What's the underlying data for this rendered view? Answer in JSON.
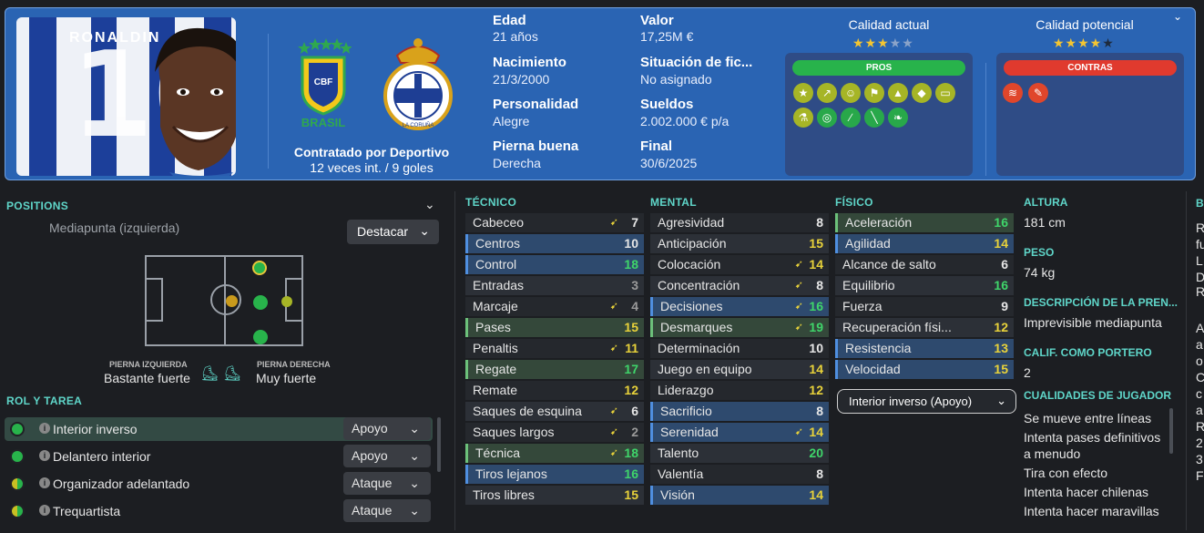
{
  "player": {
    "shirt_name": "RONALDIN",
    "shirt_number": "10",
    "nation": "BRASIL",
    "club_crest_text": "REAL CLUB DEPORTIVO · LA CORUÑA",
    "contract_line": "Contratado por Deportivo",
    "caps_line": "12 veces int. / 9 goles"
  },
  "info": {
    "edad_label": "Edad",
    "edad": "21 años",
    "nacimiento_label": "Nacimiento",
    "nacimiento": "21/3/2000",
    "personalidad_label": "Personalidad",
    "personalidad": "Alegre",
    "pierna_label": "Pierna buena",
    "pierna": "Derecha",
    "valor_label": "Valor",
    "valor": "17,25M €",
    "situacion_label": "Situación de fic...",
    "situacion": "No asignado",
    "sueldos_label": "Sueldos",
    "sueldos": "2.002.000 € p/a",
    "final_label": "Final",
    "final": "30/6/2025"
  },
  "quality": {
    "actual_label": "Calidad actual",
    "actual_stars": 3,
    "actual_half": true,
    "potencial_label": "Calidad potencial",
    "potencial_stars": 4
  },
  "pros": {
    "label": "PROS",
    "icons": [
      "star-icon",
      "trend-icon",
      "head-icon",
      "flag-icon",
      "cone-icon",
      "cones-icon",
      "pitch-icon",
      "flask-icon",
      "target-icon",
      "bandage-icon",
      "syringe-icon",
      "leaf-icon"
    ]
  },
  "contras": {
    "label": "CONTRAS",
    "icons": [
      "spring-icon",
      "clipboard-icon"
    ]
  },
  "positions": {
    "title": "POSITIONS",
    "current": "Mediapunta (izquierda)",
    "highlight_label": "Destacar",
    "left_foot_label": "PIERNA IZQUIERDA",
    "left_foot": "Bastante fuerte",
    "right_foot_label": "PIERNA DERECHA",
    "right_foot": "Muy fuerte"
  },
  "roles": {
    "title": "ROL Y TAREA",
    "items": [
      {
        "name": "Interior inverso",
        "duty": "Apoyo"
      },
      {
        "name": "Delantero interior",
        "duty": "Apoyo"
      },
      {
        "name": "Organizador adelantado",
        "duty": "Ataque"
      },
      {
        "name": "Trequartista",
        "duty": "Ataque"
      }
    ]
  },
  "tecnico": {
    "title": "TÉCNICO",
    "rows": [
      {
        "n": "Cabeceo",
        "v": "7"
      },
      {
        "n": "Centros",
        "v": "10"
      },
      {
        "n": "Control",
        "v": "18"
      },
      {
        "n": "Entradas",
        "v": "3"
      },
      {
        "n": "Marcaje",
        "v": "4"
      },
      {
        "n": "Pases",
        "v": "15"
      },
      {
        "n": "Penaltis",
        "v": "11"
      },
      {
        "n": "Regate",
        "v": "17"
      },
      {
        "n": "Remate",
        "v": "12"
      },
      {
        "n": "Saques de esquina",
        "v": "6"
      },
      {
        "n": "Saques largos",
        "v": "2"
      },
      {
        "n": "Técnica",
        "v": "18"
      },
      {
        "n": "Tiros lejanos",
        "v": "16"
      },
      {
        "n": "Tiros libres",
        "v": "15"
      }
    ]
  },
  "mental": {
    "title": "MENTAL",
    "rows": [
      {
        "n": "Agresividad",
        "v": "8"
      },
      {
        "n": "Anticipación",
        "v": "15"
      },
      {
        "n": "Colocación",
        "v": "14"
      },
      {
        "n": "Concentración",
        "v": "8"
      },
      {
        "n": "Decisiones",
        "v": "16"
      },
      {
        "n": "Desmarques",
        "v": "19"
      },
      {
        "n": "Determinación",
        "v": "10"
      },
      {
        "n": "Juego en equipo",
        "v": "14"
      },
      {
        "n": "Liderazgo",
        "v": "12"
      },
      {
        "n": "Sacrificio",
        "v": "8"
      },
      {
        "n": "Serenidad",
        "v": "14"
      },
      {
        "n": "Talento",
        "v": "20"
      },
      {
        "n": "Valentía",
        "v": "8"
      },
      {
        "n": "Visión",
        "v": "14"
      }
    ]
  },
  "fisico": {
    "title": "FÍSICO",
    "rows": [
      {
        "n": "Aceleración",
        "v": "16"
      },
      {
        "n": "Agilidad",
        "v": "14"
      },
      {
        "n": "Alcance de salto",
        "v": "6"
      },
      {
        "n": "Equilibrio",
        "v": "16"
      },
      {
        "n": "Fuerza",
        "v": "9"
      },
      {
        "n": "Recuperación físi...",
        "v": "12"
      },
      {
        "n": "Resistencia",
        "v": "13"
      },
      {
        "n": "Velocidad",
        "v": "15"
      }
    ],
    "role_select": "Interior inverso (Apoyo)"
  },
  "side": {
    "altura_label": "ALTURA",
    "altura": "181 cm",
    "peso_label": "PESO",
    "peso": "74 kg",
    "desc_label": "DESCRIPCIÓN DE LA PREN...",
    "desc": "Imprevisible mediapunta",
    "portero_label": "CALIF. COMO PORTERO",
    "portero": "2",
    "cualidades_label": "CUALIDADES DE JUGADOR",
    "cualidades": [
      "Se mueve entre líneas",
      "Intenta pases definitivos",
      "a menudo",
      "Tira con efecto",
      "Intenta hacer chilenas",
      "Intenta hacer maravillas"
    ]
  },
  "edge_text": {
    "h": "B",
    "lines": [
      "R",
      "fu",
      "L",
      "D",
      "R",
      "A",
      "a",
      "o",
      "C",
      "c",
      "a",
      "R",
      "2",
      "3",
      "F"
    ]
  }
}
